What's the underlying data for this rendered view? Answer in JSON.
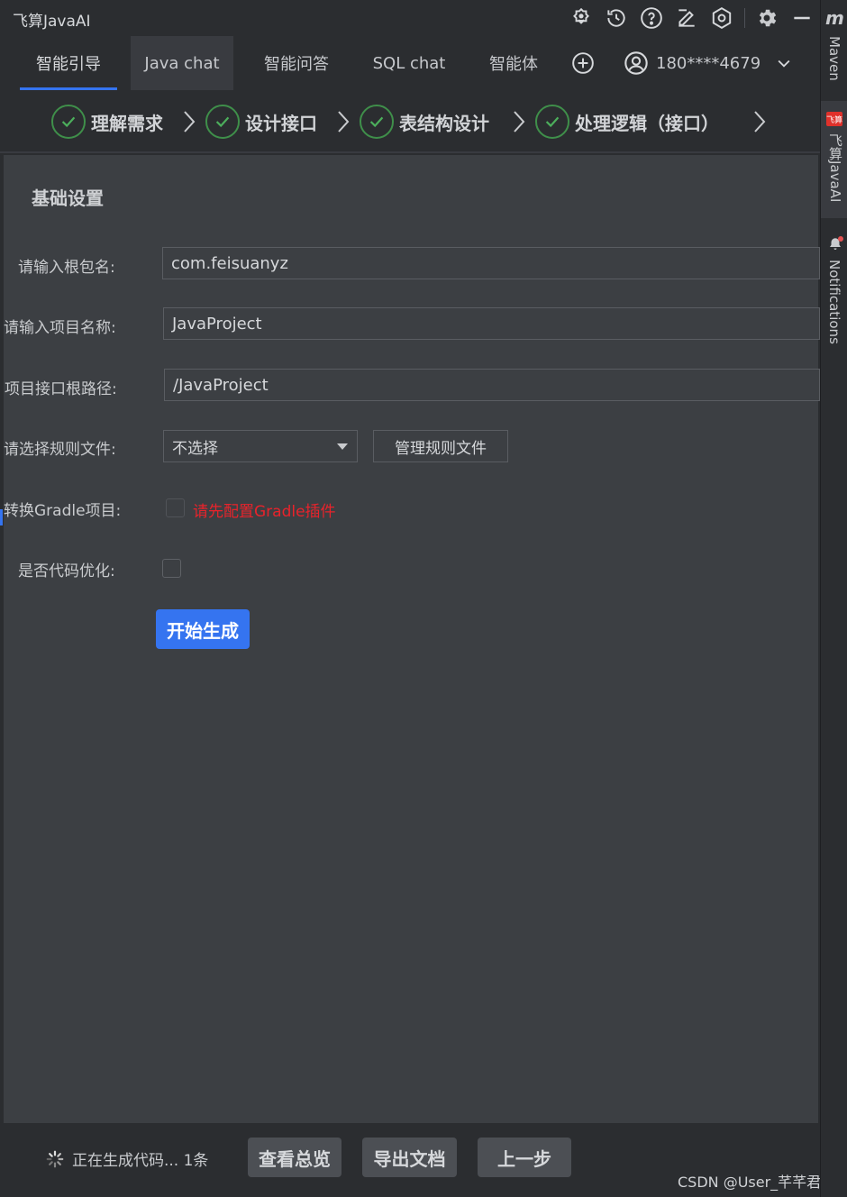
{
  "titlebar": {
    "title": "飞算JavaAI",
    "icons": [
      "bot-icon",
      "history-icon",
      "help-icon",
      "edit-icon",
      "settings-hex-icon",
      "gear-icon",
      "minimize-icon"
    ]
  },
  "tabs": [
    {
      "label": "智能引导",
      "selected": true
    },
    {
      "label": "Java chat"
    },
    {
      "label": "智能问答"
    },
    {
      "label": "SQL chat"
    },
    {
      "label": "智能体"
    }
  ],
  "user": {
    "phone": "180****4679"
  },
  "steps": [
    {
      "label": "理解需求"
    },
    {
      "label": "设计接口"
    },
    {
      "label": "表结构设计"
    },
    {
      "label": "处理逻辑（接口）"
    }
  ],
  "form": {
    "section_title": "基础设置",
    "root_package": {
      "label": "请输入根包名:",
      "value": "com.feisuanyz"
    },
    "project_name": {
      "label": "请输入项目名称:",
      "value": "JavaProject"
    },
    "api_root": {
      "label": "项目接口根路径:",
      "value": "/JavaProject"
    },
    "rule_file": {
      "label": "请选择规则文件:",
      "selected": "不选择",
      "manage_label": "管理规则文件"
    },
    "gradle": {
      "label": "转换Gradle项目:",
      "warning": "请先配置Gradle插件",
      "checked": false
    },
    "optimize": {
      "label": "是否代码优化:",
      "checked": false
    },
    "generate_label": "开始生成"
  },
  "footer": {
    "status": "正在生成代码... 1条",
    "overview_label": "查看总览",
    "export_label": "导出文档",
    "prev_label": "上一步",
    "watermark": "CSDN @User_芊芊君子"
  },
  "strip": {
    "m": "m",
    "maven": "Maven",
    "logo_text": "飞算",
    "plugin": "飞算JavaAI",
    "notifications": "Notifications"
  },
  "colors": {
    "accent": "#3574f0",
    "warning": "#e8232b",
    "check": "#3f8f4a"
  }
}
